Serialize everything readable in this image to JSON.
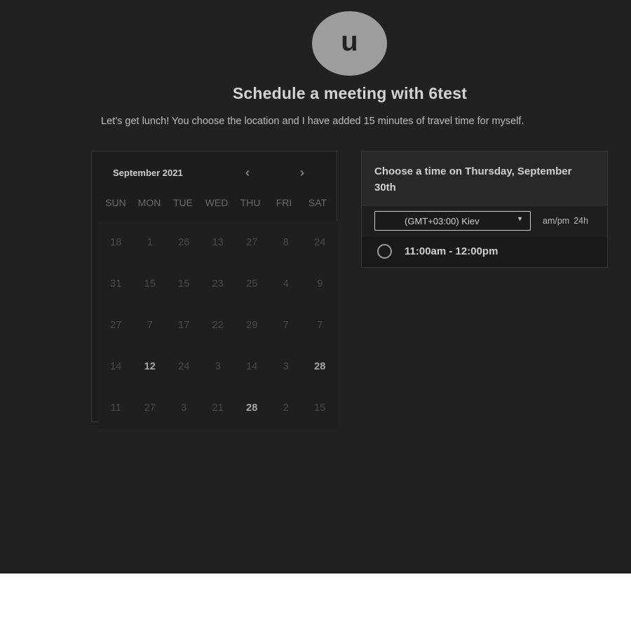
{
  "header": {
    "avatar_initial": "u",
    "title": "Schedule a meeting with 6test",
    "description": "Let’s get lunch! You choose the location and I have added 15 minutes of travel time for myself."
  },
  "calendar": {
    "month_label": "September 2021",
    "prev_label": "‹",
    "next_label": "›",
    "weekdays": [
      "SUN",
      "MON",
      "TUE",
      "WED",
      "THU",
      "FRI",
      "SAT"
    ],
    "weeks": [
      [
        {
          "d": "18",
          "a": false
        },
        {
          "d": "1",
          "a": false
        },
        {
          "d": "26",
          "a": false
        },
        {
          "d": "13",
          "a": false
        },
        {
          "d": "27",
          "a": false
        },
        {
          "d": "8",
          "a": false
        },
        {
          "d": "24",
          "a": false
        }
      ],
      [
        {
          "d": "31",
          "a": false
        },
        {
          "d": "15",
          "a": false
        },
        {
          "d": "15",
          "a": false
        },
        {
          "d": "23",
          "a": false
        },
        {
          "d": "25",
          "a": false
        },
        {
          "d": "4",
          "a": false
        },
        {
          "d": "9",
          "a": false
        }
      ],
      [
        {
          "d": "27",
          "a": false
        },
        {
          "d": "7",
          "a": false
        },
        {
          "d": "17",
          "a": false
        },
        {
          "d": "22",
          "a": false
        },
        {
          "d": "29",
          "a": false
        },
        {
          "d": "7",
          "a": false
        },
        {
          "d": "7",
          "a": false
        }
      ],
      [
        {
          "d": "14",
          "a": false
        },
        {
          "d": "12",
          "a": true
        },
        {
          "d": "24",
          "a": false
        },
        {
          "d": "3",
          "a": false
        },
        {
          "d": "14",
          "a": false
        },
        {
          "d": "3",
          "a": false
        },
        {
          "d": "28",
          "a": true
        }
      ],
      [
        {
          "d": "11",
          "a": false
        },
        {
          "d": "27",
          "a": false
        },
        {
          "d": "3",
          "a": false
        },
        {
          "d": "21",
          "a": false
        },
        {
          "d": "28",
          "a": true
        },
        {
          "d": "2",
          "a": false
        },
        {
          "d": "15",
          "a": false
        }
      ]
    ]
  },
  "times": {
    "heading": "Choose a time on Thursday, September 30th",
    "timezone": "(GMT+03:00) Kiev",
    "format_ampm": "am/pm",
    "format_24h": "24h",
    "slots": [
      "11:00am - 12:00pm"
    ]
  },
  "colors": {
    "background": "#212121",
    "avatar": "#9d9d9d",
    "text_primary": "#d4d4d4"
  }
}
